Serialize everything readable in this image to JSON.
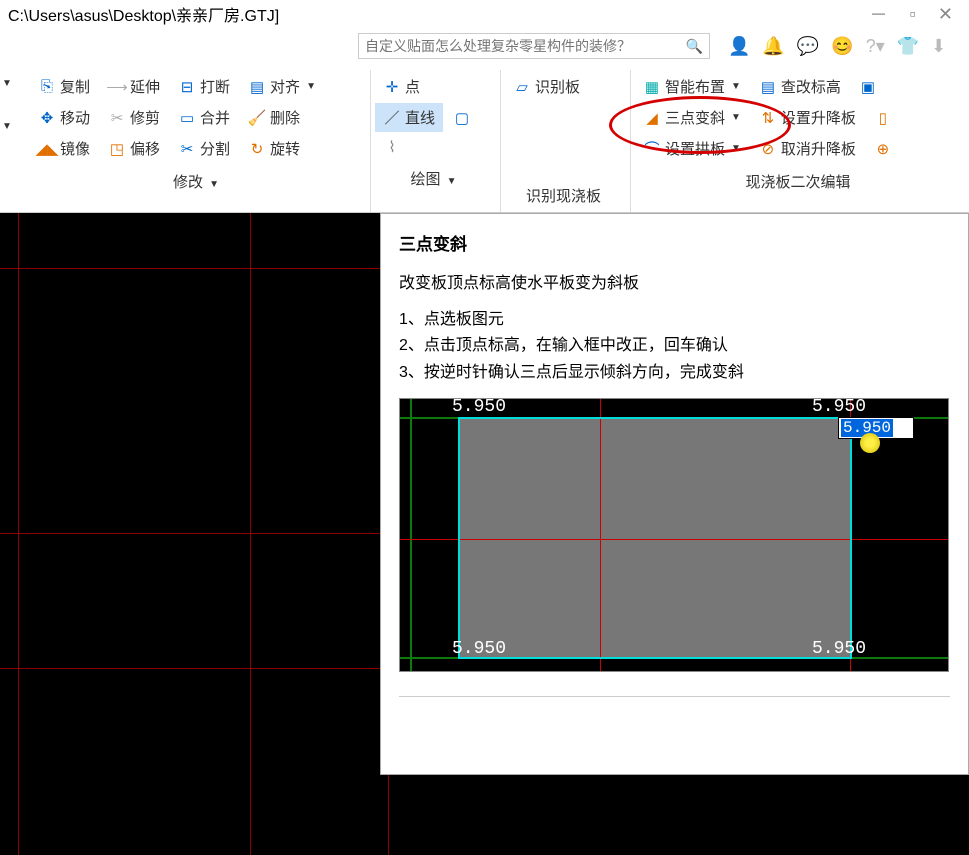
{
  "window": {
    "title": "C:\\Users\\asus\\Desktop\\亲亲厂房.GTJ]"
  },
  "search": {
    "placeholder": "自定义贴面怎么处理复杂零星构件的装修？"
  },
  "ribbon": {
    "modify": {
      "copy": "复制",
      "extend": "延伸",
      "break": "打断",
      "align": "对齐",
      "move": "移动",
      "trim": "修剪",
      "merge": "合并",
      "delete": "删除",
      "mirror": "镜像",
      "offset": "偏移",
      "split": "分割",
      "rotate": "旋转",
      "label": "修改"
    },
    "draw": {
      "point": "点",
      "line": "直线",
      "label": "绘图"
    },
    "recognize": {
      "shibie_ban": "识别板",
      "label": "识别现浇板"
    },
    "slab_edit": {
      "smart_place": "智能布置",
      "check_elev": "查改标高",
      "three_point": "三点变斜",
      "set_lift": "设置升降板",
      "set_arch": "设置拱板",
      "cancel_lift": "取消升降板",
      "label": "现浇板二次编辑"
    }
  },
  "tooltip": {
    "title": "三点变斜",
    "desc": "改变板顶点标高使水平板变为斜板",
    "step1": "1、点选板图元",
    "step2": "2、点击顶点标高，在输入框中改正，回车确认",
    "step3": "3、按逆时针确认三点后显示倾斜方向，完成变斜"
  },
  "preview": {
    "val_tl": "5.950",
    "val_tr": "5.950",
    "val_bl": "5.950",
    "val_br": "5.950",
    "edit_value": "5.950"
  }
}
